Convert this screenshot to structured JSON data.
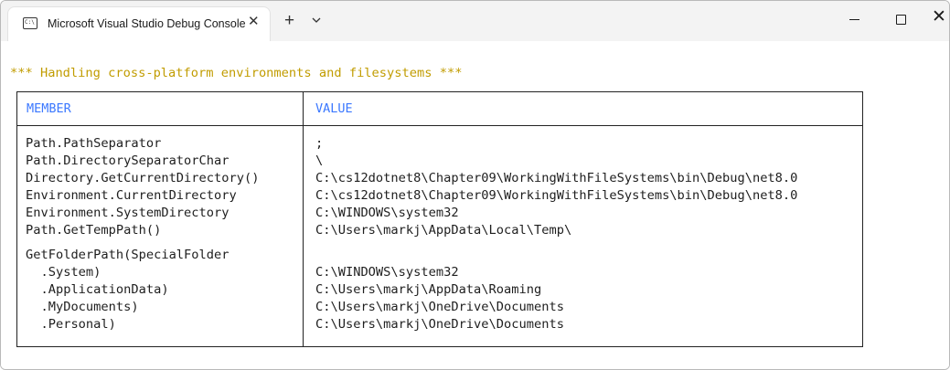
{
  "window": {
    "tab_title": "Microsoft Visual Studio Debug Console",
    "tab_icon": "console-app-icon",
    "controls": [
      "minimize",
      "maximize",
      "close"
    ]
  },
  "console": {
    "heading": "*** Handling cross-platform environments and filesystems ***",
    "heading_color": "#c19c00",
    "header_color": "#3b78ff",
    "table": {
      "columns": [
        "MEMBER",
        "VALUE"
      ],
      "rows": [
        {
          "member": "Path.PathSeparator",
          "value": ";"
        },
        {
          "member": "Path.DirectorySeparatorChar",
          "value": "\\"
        },
        {
          "member": "Directory.GetCurrentDirectory()",
          "value": "C:\\cs12dotnet8\\Chapter09\\WorkingWithFileSystems\\bin\\Debug\\net8.0"
        },
        {
          "member": "Environment.CurrentDirectory",
          "value": "C:\\cs12dotnet8\\Chapter09\\WorkingWithFileSystems\\bin\\Debug\\net8.0"
        },
        {
          "member": "Environment.SystemDirectory",
          "value": "C:\\WINDOWS\\system32"
        },
        {
          "member": "Path.GetTempPath()",
          "value": "C:\\Users\\markj\\AppData\\Local\\Temp\\"
        },
        {
          "member": "",
          "value": ""
        },
        {
          "member": "GetFolderPath(SpecialFolder",
          "value": ""
        },
        {
          "member": "  .System)",
          "value": "C:\\WINDOWS\\system32"
        },
        {
          "member": "  .ApplicationData)",
          "value": "C:\\Users\\markj\\AppData\\Roaming"
        },
        {
          "member": "  .MyDocuments)",
          "value": "C:\\Users\\markj\\OneDrive\\Documents"
        },
        {
          "member": "  .Personal)",
          "value": "C:\\Users\\markj\\OneDrive\\Documents"
        }
      ]
    }
  }
}
